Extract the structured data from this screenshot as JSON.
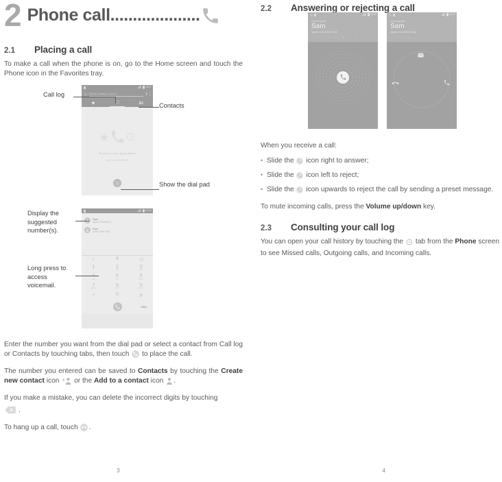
{
  "chapter": {
    "number": "2",
    "title": "Phone call",
    "dots": "....................",
    "icon": "phone-handset-icon"
  },
  "left_column": {
    "section_2_1": {
      "number": "2.1",
      "title": "Placing a call",
      "intro": "To make a call when the phone is on, go to the Home screen and touch the Phone icon in the Favorites tray."
    },
    "callouts": {
      "call_log": "Call log",
      "contacts": "Contacts",
      "show_dial_pad": "Show the dial pad",
      "display_suggested": "Display the suggested number(s).",
      "long_press_voicemail": "Long press to access voicemail."
    },
    "paragraphs": {
      "p1_a": "Enter the number you want from the dial pad or select a contact from Call log or Contacts by touching tabs, then touch ",
      "p1_b": " to place the call.",
      "p2_a": "The number you entered can be saved to ",
      "p2_contacts": "Contacts",
      "p2_b": " by touching the ",
      "p2_create": "Create new contact",
      "p2_c": " icon ",
      "p2_d": " or the ",
      "p2_add": "Add to a contact",
      "p2_e": " icon ",
      "p2_f": ".",
      "p3_a": "If you make a mistake, you can delete the incorrect digits by touching ",
      "p3_b": " .",
      "p4_a": "To hang up a call, touch ",
      "p4_b": "."
    },
    "screenshot_dialer": {
      "status_time": "10:17",
      "search_placeholder": "Search contacts or phone...",
      "tabs": [
        "favorites-star",
        "call-log-clock",
        "contacts-people"
      ],
      "empty_title": "No one is on your speed dial yet",
      "empty_cta": "ADD A FAVORITE",
      "fab": "dialpad-icon"
    },
    "screenshot_keypad": {
      "status_time": "14:24",
      "suggestions": [
        {
          "name": "Sam",
          "number": "Mobile 13916033 9"
        },
        {
          "name": "Sam",
          "number": "Mobile 3905 1530"
        }
      ],
      "toolbar": {
        "overflow": "more-icon",
        "zero": "0",
        "backspace": "backspace-icon"
      },
      "keys": [
        {
          "num": "1",
          "sub": "∞"
        },
        {
          "num": "2",
          "sub": "ABC"
        },
        {
          "num": "3",
          "sub": "DEF"
        },
        {
          "num": "4",
          "sub": "GHI"
        },
        {
          "num": "5",
          "sub": "JKL"
        },
        {
          "num": "6",
          "sub": "MNO"
        },
        {
          "num": "7",
          "sub": "PQRS"
        },
        {
          "num": "8",
          "sub": "TUV"
        },
        {
          "num": "9",
          "sub": "WXYZ"
        },
        {
          "num": "*",
          "sub": ""
        },
        {
          "num": "0",
          "sub": "+"
        },
        {
          "num": "#",
          "sub": ""
        }
      ],
      "hide_label": "HIDE"
    },
    "page_number": "3"
  },
  "right_column": {
    "section_2_2": {
      "number": "2.2",
      "title": "Answering or rejecting a call",
      "intro": "When you receive a call:",
      "bullets": [
        {
          "a": "Slide the ",
          "b": " icon right to answer;"
        },
        {
          "a": "Slide the ",
          "b": " icon left to reject;"
        },
        {
          "a": "Slide the ",
          "b": " icon upwards to reject the call by sending a preset message."
        }
      ],
      "mute_a": "To mute incoming calls, press the ",
      "mute_b": "Volume up/down",
      "mute_c": " key."
    },
    "section_2_3": {
      "number": "2.3",
      "title": "Consulting your call log",
      "body_a": "You can open your call history by touching the ",
      "body_b": " tab from the ",
      "body_phone": "Phone",
      "body_c": " screen to see Missed calls, Outgoing calls, and Incoming calls."
    },
    "screenshot_incoming_a": {
      "status_time": "14:30",
      "label": "Incoming call",
      "name": "Sam",
      "number": "Mobile 020 8836 1598"
    },
    "screenshot_incoming_b": {
      "status_time": "14:31",
      "label": "Incoming call",
      "name": "Sam",
      "number": "Mobile 020 8836 1598"
    },
    "page_number": "4"
  },
  "colors": {
    "text": "#58595b",
    "heading": "#3f4043",
    "chapter_number": "#a7a9ac",
    "shot_chrome": "#9b9b9b",
    "shot_body": "#ececec"
  }
}
